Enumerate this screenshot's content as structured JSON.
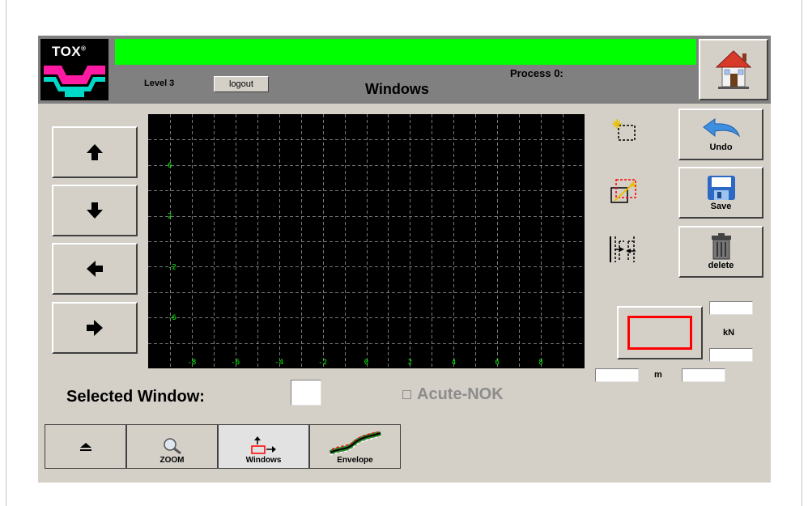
{
  "header": {
    "logo_text": "TOX",
    "logo_mark": "®",
    "level": "Level 3",
    "logout_label": "logout",
    "process": "Process 0:",
    "title": "Windows",
    "status_color": "#00ff00"
  },
  "home": {
    "icon": "house-icon"
  },
  "nav": {
    "up_icon": "arrow-up-icon",
    "down_icon": "arrow-down-icon",
    "left_icon": "arrow-left-icon",
    "right_icon": "arrow-right-icon"
  },
  "plot": {
    "x_ticks": [
      "-8",
      "-6",
      "-4",
      "-2",
      "0",
      "2",
      "4",
      "6",
      "8"
    ],
    "y_ticks": [
      "6",
      "2",
      "-2",
      "-6"
    ],
    "grid": true,
    "background": "#000000",
    "tick_color": "#00ff00"
  },
  "tools": {
    "new_window_icon": "new-window-icon",
    "resize_window_icon": "resize-window-icon",
    "align_windows_icon": "align-windows-icon"
  },
  "actions": {
    "undo_label": "Undo",
    "save_label": "Save",
    "delete_label": "delete"
  },
  "window_box": {
    "color": "#ff0000"
  },
  "units": {
    "force": "kN",
    "distance": "m"
  },
  "selected_window": {
    "label": "Selected Window:",
    "value": ""
  },
  "acute": {
    "label": "Acute-NOK",
    "checked": false
  },
  "tabs": [
    {
      "label": "",
      "icon": "eject-icon"
    },
    {
      "label": "ZOOM",
      "icon": "zoom-icon"
    },
    {
      "label": "Windows",
      "icon": "windows-icon"
    },
    {
      "label": "Envelope",
      "icon": "envelope-curve-icon"
    }
  ]
}
